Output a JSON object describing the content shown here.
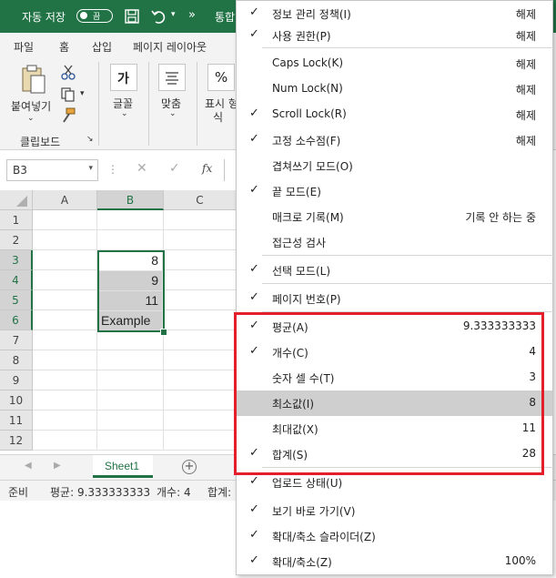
{
  "titlebar": {
    "autosave_label": "자동 저장",
    "toggle_label": "끔",
    "title_fragment": "통합"
  },
  "tabs": [
    "파일",
    "홈",
    "삽입",
    "페이지 레이아웃"
  ],
  "ribbon": {
    "paste": "붙여넣기",
    "clipboard": "클립보드",
    "font": "글꼴",
    "font_glyph": "가",
    "align": "맞춤",
    "display_format_1": "표시 형",
    "display_format_2": "식",
    "percent": "%"
  },
  "formula": {
    "namebox": "B3",
    "fx": "fx"
  },
  "grid": {
    "columns": [
      "A",
      "B",
      "C"
    ],
    "rows": [
      "1",
      "2",
      "3",
      "4",
      "5",
      "6",
      "7",
      "8",
      "9",
      "10",
      "11",
      "12"
    ],
    "cells": {
      "b3": "8",
      "b4": "9",
      "b5": "11",
      "b6": "Example"
    }
  },
  "sheets": {
    "active": "Sheet1",
    "add": "+"
  },
  "status": {
    "ready": "준비",
    "average": "평균: 9.333333333",
    "count": "개수: 4",
    "sum": "합계:"
  },
  "menu": {
    "items": [
      {
        "label": "정보 관리 정책(I)",
        "value": "해제",
        "checked": true
      },
      {
        "label": "사용 권한(P)",
        "value": "해제",
        "checked": true
      },
      {
        "label": "Caps Lock(K)",
        "value": "해제",
        "checked": false
      },
      {
        "label": "Num Lock(N)",
        "value": "해제",
        "checked": false
      },
      {
        "label": "Scroll Lock(R)",
        "value": "해제",
        "checked": true
      },
      {
        "label": "고정 소수점(F)",
        "value": "해제",
        "checked": true
      },
      {
        "label": "겹쳐쓰기 모드(O)",
        "value": "",
        "checked": false
      },
      {
        "label": "끝 모드(E)",
        "value": "",
        "checked": true
      },
      {
        "label": "매크로 기록(M)",
        "value": "기록 안 하는 중",
        "checked": false
      },
      {
        "label": "접근성 검사",
        "value": "",
        "checked": false
      },
      {
        "label": "선택 모드(L)",
        "value": "",
        "checked": true
      },
      {
        "label": "페이지 번호(P)",
        "value": "",
        "checked": true
      },
      {
        "label": "평균(A)",
        "value": "9.333333333",
        "checked": true
      },
      {
        "label": "개수(C)",
        "value": "4",
        "checked": true
      },
      {
        "label": "숫자 셀 수(T)",
        "value": "3",
        "checked": false
      },
      {
        "label": "최소값(I)",
        "value": "8",
        "checked": false
      },
      {
        "label": "최대값(X)",
        "value": "11",
        "checked": false
      },
      {
        "label": "합계(S)",
        "value": "28",
        "checked": true
      },
      {
        "label": "업로드 상태(U)",
        "value": "",
        "checked": true
      },
      {
        "label": "보기 바로 가기(V)",
        "value": "",
        "checked": true
      },
      {
        "label": "확대/축소 슬라이더(Z)",
        "value": "",
        "checked": true
      },
      {
        "label": "확대/축소(Z)",
        "value": "100%",
        "checked": true
      }
    ],
    "check_glyph": "✓"
  },
  "colors": {
    "excel_green": "#217346",
    "highlight_red": "#e41e2a",
    "menu_highlight": "#cfcfcf"
  }
}
